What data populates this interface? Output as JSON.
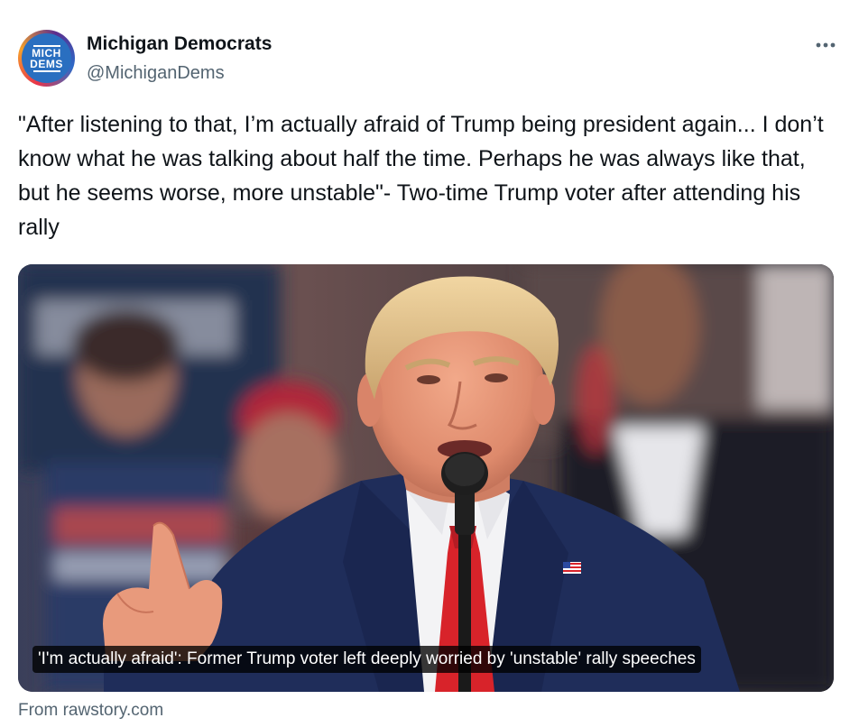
{
  "author": {
    "display_name": "Michigan Democrats",
    "handle": "@MichiganDems",
    "avatar_line1": "MICH",
    "avatar_line2": "DEMS"
  },
  "more_icon": "more-horizontal-icon",
  "tweet": {
    "text": "\"After listening to that, I’m actually afraid of Trump being president again... I don’t know what he was talking about half the time. Perhaps he was always like that, but he seems worse, more unstable\"- Two-time Trump voter after attending his rally"
  },
  "card": {
    "caption": "'I'm actually afraid': Former Trump voter left deeply worried by 'unstable' rally speeches",
    "source": "From rawstory.com"
  },
  "colors": {
    "text": "#0f1419",
    "secondary": "#536471",
    "avatar_blue": "#2a6fc0",
    "tie_red": "#d8232a",
    "suit_navy": "#1f2d5a"
  }
}
